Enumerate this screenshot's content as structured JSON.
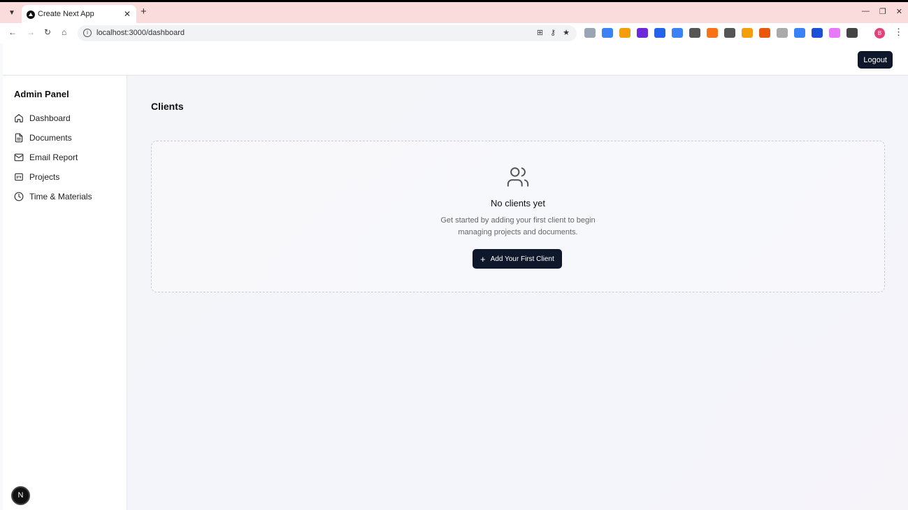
{
  "browser": {
    "tab_title": "Create Next App",
    "tab_close": "✕",
    "new_tab": "+",
    "url": "localhost:3000/dashboard",
    "extensions": [
      "#9aa5b4",
      "#3b82f6",
      "#f59e0b",
      "#6d28d9",
      "#2563eb",
      "#3b82f6",
      "#555",
      "#f97316",
      "#555",
      "#f59e0b",
      "#ea580c",
      "#aaa",
      "#3b82f6",
      "#1d4ed8",
      "#e879f9",
      "#444"
    ],
    "profile_initial": "B"
  },
  "header": {
    "logout_label": "Logout"
  },
  "sidebar": {
    "title": "Admin Panel",
    "items": [
      {
        "label": "Dashboard"
      },
      {
        "label": "Documents"
      },
      {
        "label": "Email Report"
      },
      {
        "label": "Projects"
      },
      {
        "label": "Time & Materials"
      }
    ]
  },
  "main": {
    "page_title": "Clients",
    "empty_state": {
      "heading": "No clients yet",
      "description": "Get started by adding your first client to begin managing projects and documents.",
      "button_label": "Add Your First Client"
    }
  },
  "next_badge": "N"
}
